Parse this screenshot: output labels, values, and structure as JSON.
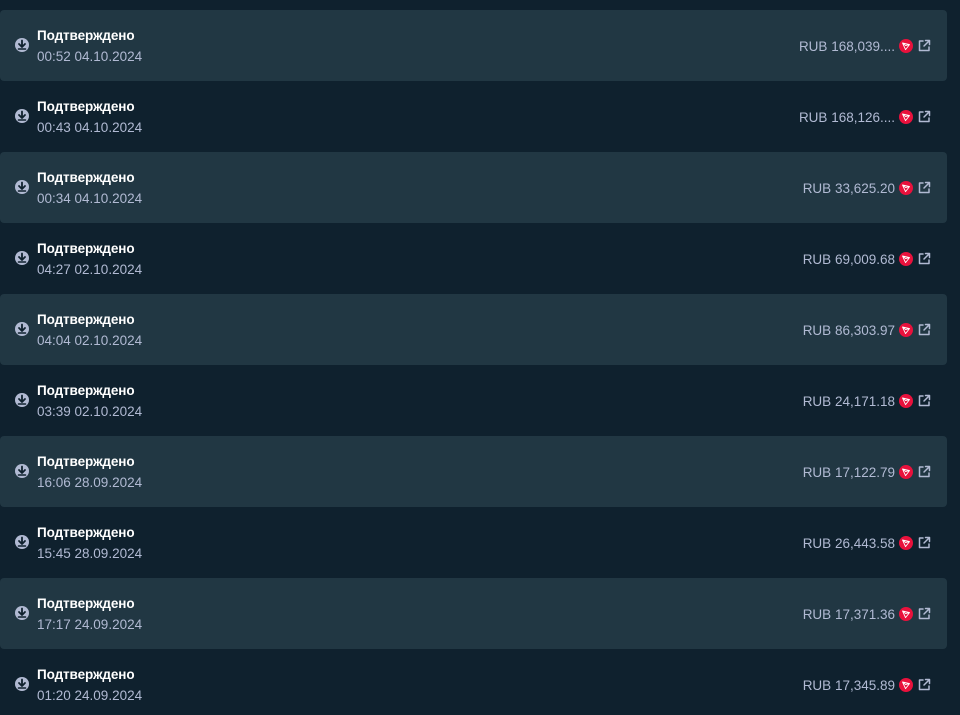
{
  "icons": {
    "download": "download-circle-icon",
    "currency": "tron-coin-icon",
    "external": "external-link-icon"
  },
  "colors": {
    "background": "#0f212e",
    "row_shaded": "#213743",
    "text_primary": "#ffffff",
    "text_secondary": "#b1bad3",
    "coin": "#e9113c"
  },
  "transactions": [
    {
      "status": "Подтверждено",
      "time": "00:52 04.10.2024",
      "amount": "RUB 168,039...."
    },
    {
      "status": "Подтверждено",
      "time": "00:43 04.10.2024",
      "amount": "RUB 168,126...."
    },
    {
      "status": "Подтверждено",
      "time": "00:34 04.10.2024",
      "amount": "RUB 33,625.20"
    },
    {
      "status": "Подтверждено",
      "time": "04:27 02.10.2024",
      "amount": "RUB 69,009.68"
    },
    {
      "status": "Подтверждено",
      "time": "04:04 02.10.2024",
      "amount": "RUB 86,303.97"
    },
    {
      "status": "Подтверждено",
      "time": "03:39 02.10.2024",
      "amount": "RUB 24,171.18"
    },
    {
      "status": "Подтверждено",
      "time": "16:06 28.09.2024",
      "amount": "RUB 17,122.79"
    },
    {
      "status": "Подтверждено",
      "time": "15:45 28.09.2024",
      "amount": "RUB 26,443.58"
    },
    {
      "status": "Подтверждено",
      "time": "17:17 24.09.2024",
      "amount": "RUB 17,371.36"
    },
    {
      "status": "Подтверждено",
      "time": "01:20 24.09.2024",
      "amount": "RUB 17,345.89"
    }
  ]
}
